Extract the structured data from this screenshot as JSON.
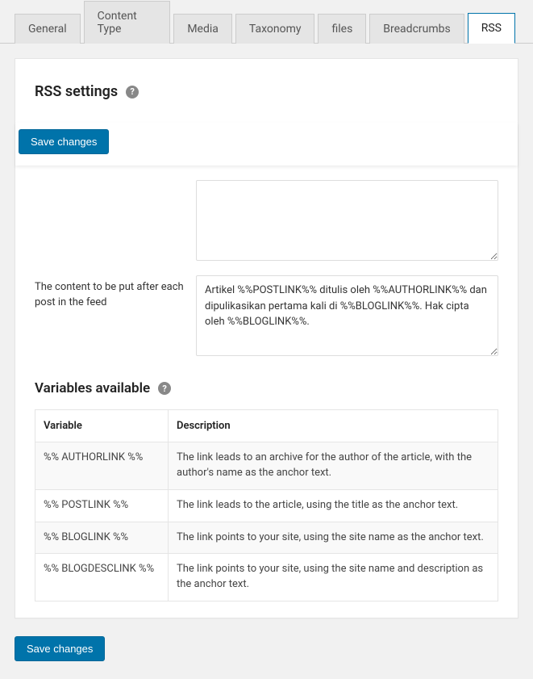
{
  "tabs": [
    {
      "label": "General",
      "active": false
    },
    {
      "label": "Content Type",
      "active": false
    },
    {
      "label": "Media",
      "active": false
    },
    {
      "label": "Taxonomy",
      "active": false
    },
    {
      "label": "files",
      "active": false
    },
    {
      "label": "Breadcrumbs",
      "active": false
    },
    {
      "label": "RSS",
      "active": true
    }
  ],
  "section": {
    "title": "RSS settings"
  },
  "buttons": {
    "save": "Save changes"
  },
  "fields": {
    "before": {
      "label": "",
      "value": ""
    },
    "after": {
      "label": "The content to be put after each post in the feed",
      "value": "Artikel %%POSTLINK%% ditulis oleh %%AUTHORLINK%% dan dipulikasikan pertama kali di %%BLOGLINK%%. Hak cipta oleh %%BLOGLINK%%."
    }
  },
  "variables": {
    "title": "Variables available",
    "headers": {
      "var": "Variable",
      "desc": "Description"
    },
    "rows": [
      {
        "var": "%% AUTHORLINK %%",
        "desc": "The link leads to an archive for the author of the article, with the author's name as the anchor text."
      },
      {
        "var": "%% POSTLINK %%",
        "desc": "The link leads to the article, using the title as the anchor text."
      },
      {
        "var": "%% BLOGLINK %%",
        "desc": "The link points to your site, using the site name as the anchor text."
      },
      {
        "var": "%% BLOGDESCLINK %%",
        "desc": "The link points to your site, using the site name and description as the anchor text."
      }
    ]
  }
}
